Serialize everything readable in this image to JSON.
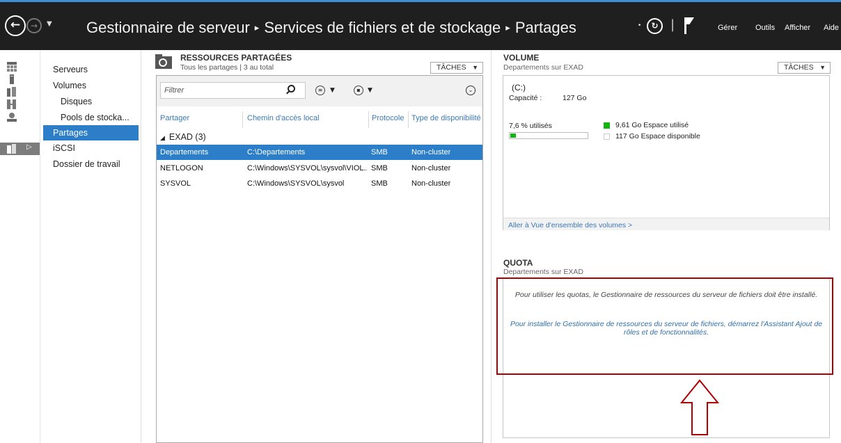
{
  "titlebar": {
    "breadcrumb": [
      "Gestionnaire de serveur",
      "Services de fichiers et de stockage",
      "Partages"
    ],
    "separator": "▸",
    "menu": [
      "Gérer",
      "Outils",
      "Afficher",
      "Aide"
    ]
  },
  "nav": {
    "items": [
      {
        "label": "Serveurs",
        "sub": false,
        "selected": false
      },
      {
        "label": "Volumes",
        "sub": false,
        "selected": false
      },
      {
        "label": "Disques",
        "sub": true,
        "selected": false
      },
      {
        "label": "Pools de stocka...",
        "sub": true,
        "selected": false
      },
      {
        "label": "Partages",
        "sub": false,
        "selected": true
      },
      {
        "label": "iSCSI",
        "sub": false,
        "selected": false
      },
      {
        "label": "Dossier de travail",
        "sub": false,
        "selected": false
      }
    ]
  },
  "shares": {
    "title": "RESSOURCES PARTAGÉES",
    "subtitle": "Tous les partages | 3 au total",
    "tasks_label": "TÂCHES",
    "filter_placeholder": "Filtrer",
    "columns": [
      "Partager",
      "Chemin d'accès local",
      "Protocole",
      "Type de disponibilité"
    ],
    "group": "EXAD (3)",
    "rows": [
      {
        "name": "Departements",
        "path": "C:\\Departements",
        "protocol": "SMB",
        "availability": "Non-cluster",
        "selected": true
      },
      {
        "name": "NETLOGON",
        "path": "C:\\Windows\\SYSVOL\\sysvol\\VIOL...",
        "protocol": "SMB",
        "availability": "Non-cluster",
        "selected": false
      },
      {
        "name": "SYSVOL",
        "path": "C:\\Windows\\SYSVOL\\sysvol",
        "protocol": "SMB",
        "availability": "Non-cluster",
        "selected": false
      }
    ]
  },
  "volume": {
    "title": "VOLUME",
    "subtitle": "Departements sur EXAD",
    "tasks_label": "TÂCHES",
    "drive": "(C:)",
    "capacity_label": "Capacité :",
    "capacity_value": "127 Go",
    "used_pct_label": "7,6 % utilisés",
    "used_fraction": 0.076,
    "used_legend": "9,61 Go Espace utilisé",
    "free_legend": "117 Go Espace disponible",
    "used_color": "#12b312",
    "link": "Aller à Vue d'ensemble des volumes >"
  },
  "quota": {
    "title": "QUOTA",
    "subtitle": "Departements sur EXAD",
    "message1": "Pour utiliser les quotas, le Gestionnaire de ressources du serveur de fichiers doit être installé.",
    "message2_line1": "Pour installer le Gestionnaire de ressources du serveur de fichiers, démarrez l'Assistant Ajout de",
    "message2_line2": "rôles et de fonctionnalités."
  },
  "annotation": {
    "color": "#b00000"
  },
  "colors": {
    "accent": "#2b7ec7",
    "titlebar": "#1f1f1f",
    "link": "#3a7ab8"
  }
}
